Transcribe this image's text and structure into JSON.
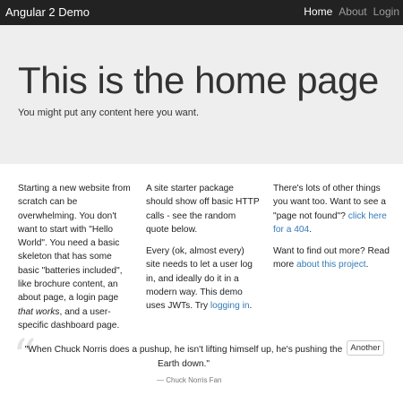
{
  "navbar": {
    "brand": "Angular 2 Demo",
    "links": [
      {
        "label": "Home",
        "active": true
      },
      {
        "label": "About",
        "active": false
      },
      {
        "label": "Login",
        "active": false
      }
    ]
  },
  "jumbotron": {
    "title": "This is the home page",
    "subtitle": "You might put any content here you want."
  },
  "columns": {
    "col1": {
      "p1_a": "Starting a new website from scratch can be overwhelming. You don't want to start with \"Hello World\". You need a basic skeleton that has some basic \"batteries included\", like brochure content, an about page, a login page ",
      "p1_em": "that works",
      "p1_b": ", and a user-specific dashboard page."
    },
    "col2": {
      "p1": "A site starter package should show off basic HTTP calls - see the random quote below.",
      "p2_a": "Every (ok, almost every) site needs to let a user log in, and ideally do it in a modern way. This demo uses JWTs. Try ",
      "p2_link": "logging in",
      "p2_b": "."
    },
    "col3": {
      "p1_a": "There's lots of other things you want too. Want to see a \"page not found\"? ",
      "p1_link": "click here for a 404",
      "p1_b": ".",
      "p2_a": "Want to find out more? Read more ",
      "p2_link": "about this project",
      "p2_b": "."
    }
  },
  "quote": {
    "mark": "“",
    "text": "\"When Chuck Norris does a pushup, he isn't lifting himself up, he's pushing the Earth down.\"",
    "author": "— Chuck Norris Fan",
    "button_label": "Another"
  },
  "colors": {
    "navbar_bg": "#222222",
    "jumbotron_bg": "#eeeeee",
    "link": "#337ab7"
  }
}
